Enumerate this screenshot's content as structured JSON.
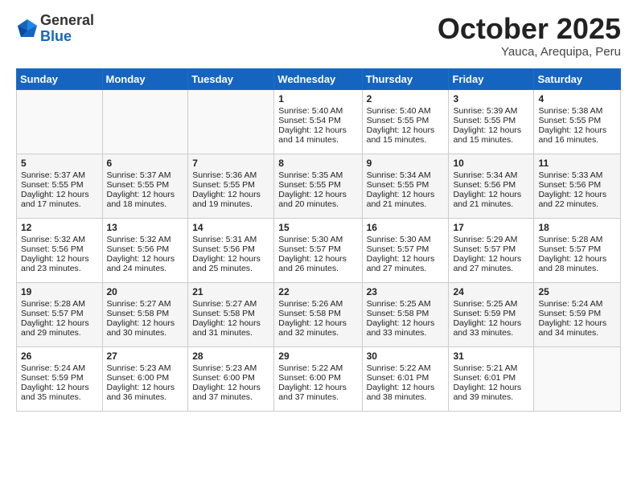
{
  "header": {
    "logo_general": "General",
    "logo_blue": "Blue",
    "month_title": "October 2025",
    "location": "Yauca, Arequipa, Peru"
  },
  "days_of_week": [
    "Sunday",
    "Monday",
    "Tuesday",
    "Wednesday",
    "Thursday",
    "Friday",
    "Saturday"
  ],
  "weeks": [
    [
      {
        "num": "",
        "info": ""
      },
      {
        "num": "",
        "info": ""
      },
      {
        "num": "",
        "info": ""
      },
      {
        "num": "1",
        "info": "Sunrise: 5:40 AM\nSunset: 5:54 PM\nDaylight: 12 hours\nand 14 minutes."
      },
      {
        "num": "2",
        "info": "Sunrise: 5:40 AM\nSunset: 5:55 PM\nDaylight: 12 hours\nand 15 minutes."
      },
      {
        "num": "3",
        "info": "Sunrise: 5:39 AM\nSunset: 5:55 PM\nDaylight: 12 hours\nand 15 minutes."
      },
      {
        "num": "4",
        "info": "Sunrise: 5:38 AM\nSunset: 5:55 PM\nDaylight: 12 hours\nand 16 minutes."
      }
    ],
    [
      {
        "num": "5",
        "info": "Sunrise: 5:37 AM\nSunset: 5:55 PM\nDaylight: 12 hours\nand 17 minutes."
      },
      {
        "num": "6",
        "info": "Sunrise: 5:37 AM\nSunset: 5:55 PM\nDaylight: 12 hours\nand 18 minutes."
      },
      {
        "num": "7",
        "info": "Sunrise: 5:36 AM\nSunset: 5:55 PM\nDaylight: 12 hours\nand 19 minutes."
      },
      {
        "num": "8",
        "info": "Sunrise: 5:35 AM\nSunset: 5:55 PM\nDaylight: 12 hours\nand 20 minutes."
      },
      {
        "num": "9",
        "info": "Sunrise: 5:34 AM\nSunset: 5:55 PM\nDaylight: 12 hours\nand 21 minutes."
      },
      {
        "num": "10",
        "info": "Sunrise: 5:34 AM\nSunset: 5:56 PM\nDaylight: 12 hours\nand 21 minutes."
      },
      {
        "num": "11",
        "info": "Sunrise: 5:33 AM\nSunset: 5:56 PM\nDaylight: 12 hours\nand 22 minutes."
      }
    ],
    [
      {
        "num": "12",
        "info": "Sunrise: 5:32 AM\nSunset: 5:56 PM\nDaylight: 12 hours\nand 23 minutes."
      },
      {
        "num": "13",
        "info": "Sunrise: 5:32 AM\nSunset: 5:56 PM\nDaylight: 12 hours\nand 24 minutes."
      },
      {
        "num": "14",
        "info": "Sunrise: 5:31 AM\nSunset: 5:56 PM\nDaylight: 12 hours\nand 25 minutes."
      },
      {
        "num": "15",
        "info": "Sunrise: 5:30 AM\nSunset: 5:57 PM\nDaylight: 12 hours\nand 26 minutes."
      },
      {
        "num": "16",
        "info": "Sunrise: 5:30 AM\nSunset: 5:57 PM\nDaylight: 12 hours\nand 27 minutes."
      },
      {
        "num": "17",
        "info": "Sunrise: 5:29 AM\nSunset: 5:57 PM\nDaylight: 12 hours\nand 27 minutes."
      },
      {
        "num": "18",
        "info": "Sunrise: 5:28 AM\nSunset: 5:57 PM\nDaylight: 12 hours\nand 28 minutes."
      }
    ],
    [
      {
        "num": "19",
        "info": "Sunrise: 5:28 AM\nSunset: 5:57 PM\nDaylight: 12 hours\nand 29 minutes."
      },
      {
        "num": "20",
        "info": "Sunrise: 5:27 AM\nSunset: 5:58 PM\nDaylight: 12 hours\nand 30 minutes."
      },
      {
        "num": "21",
        "info": "Sunrise: 5:27 AM\nSunset: 5:58 PM\nDaylight: 12 hours\nand 31 minutes."
      },
      {
        "num": "22",
        "info": "Sunrise: 5:26 AM\nSunset: 5:58 PM\nDaylight: 12 hours\nand 32 minutes."
      },
      {
        "num": "23",
        "info": "Sunrise: 5:25 AM\nSunset: 5:58 PM\nDaylight: 12 hours\nand 33 minutes."
      },
      {
        "num": "24",
        "info": "Sunrise: 5:25 AM\nSunset: 5:59 PM\nDaylight: 12 hours\nand 33 minutes."
      },
      {
        "num": "25",
        "info": "Sunrise: 5:24 AM\nSunset: 5:59 PM\nDaylight: 12 hours\nand 34 minutes."
      }
    ],
    [
      {
        "num": "26",
        "info": "Sunrise: 5:24 AM\nSunset: 5:59 PM\nDaylight: 12 hours\nand 35 minutes."
      },
      {
        "num": "27",
        "info": "Sunrise: 5:23 AM\nSunset: 6:00 PM\nDaylight: 12 hours\nand 36 minutes."
      },
      {
        "num": "28",
        "info": "Sunrise: 5:23 AM\nSunset: 6:00 PM\nDaylight: 12 hours\nand 37 minutes."
      },
      {
        "num": "29",
        "info": "Sunrise: 5:22 AM\nSunset: 6:00 PM\nDaylight: 12 hours\nand 37 minutes."
      },
      {
        "num": "30",
        "info": "Sunrise: 5:22 AM\nSunset: 6:01 PM\nDaylight: 12 hours\nand 38 minutes."
      },
      {
        "num": "31",
        "info": "Sunrise: 5:21 AM\nSunset: 6:01 PM\nDaylight: 12 hours\nand 39 minutes."
      },
      {
        "num": "",
        "info": ""
      }
    ]
  ]
}
